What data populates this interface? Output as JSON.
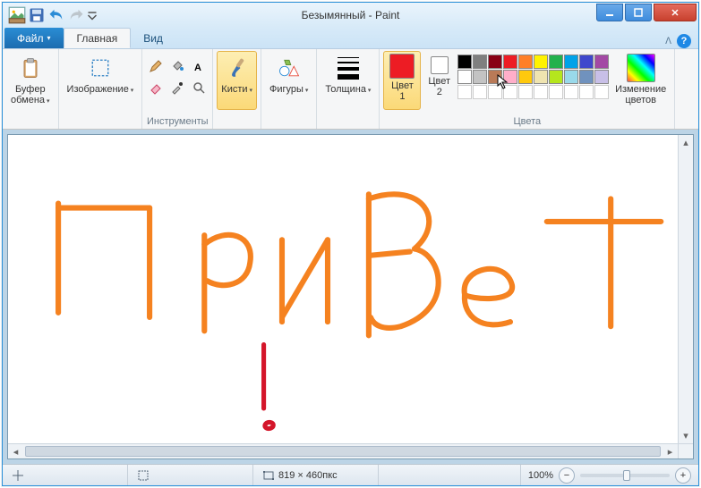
{
  "title": "Безымянный - Paint",
  "tabs": {
    "file": "Файл",
    "home": "Главная",
    "view": "Вид"
  },
  "ribbon": {
    "clipboard": {
      "btn": "Буфер\nобмена",
      "group": ""
    },
    "image": {
      "btn": "Изображение",
      "group": ""
    },
    "tools_group": "Инструменты",
    "brushes": "Кисти",
    "shapes": "Фигуры",
    "thickness": "Толщина",
    "color1": "Цвет\n1",
    "color2": "Цвет\n2",
    "colors_group": "Цвета",
    "edit_colors": "Изменение\nцветов"
  },
  "palette": {
    "row1": [
      "#000000",
      "#7f7f7f",
      "#880015",
      "#ed1c24",
      "#ff7f27",
      "#fff200",
      "#22b14c",
      "#00a2e8",
      "#3f48cc",
      "#a349a4"
    ],
    "row2": [
      "#ffffff",
      "#c3c3c3",
      "#b97a57",
      "#ffaec9",
      "#ffc90e",
      "#efe4b0",
      "#b5e61d",
      "#99d9ea",
      "#7092be",
      "#c8bfe7"
    ]
  },
  "active_color1": "#ed1c24",
  "active_color2": "#ffffff",
  "status": {
    "canvas_size": "819 × 460пкс",
    "zoom": "100%"
  }
}
